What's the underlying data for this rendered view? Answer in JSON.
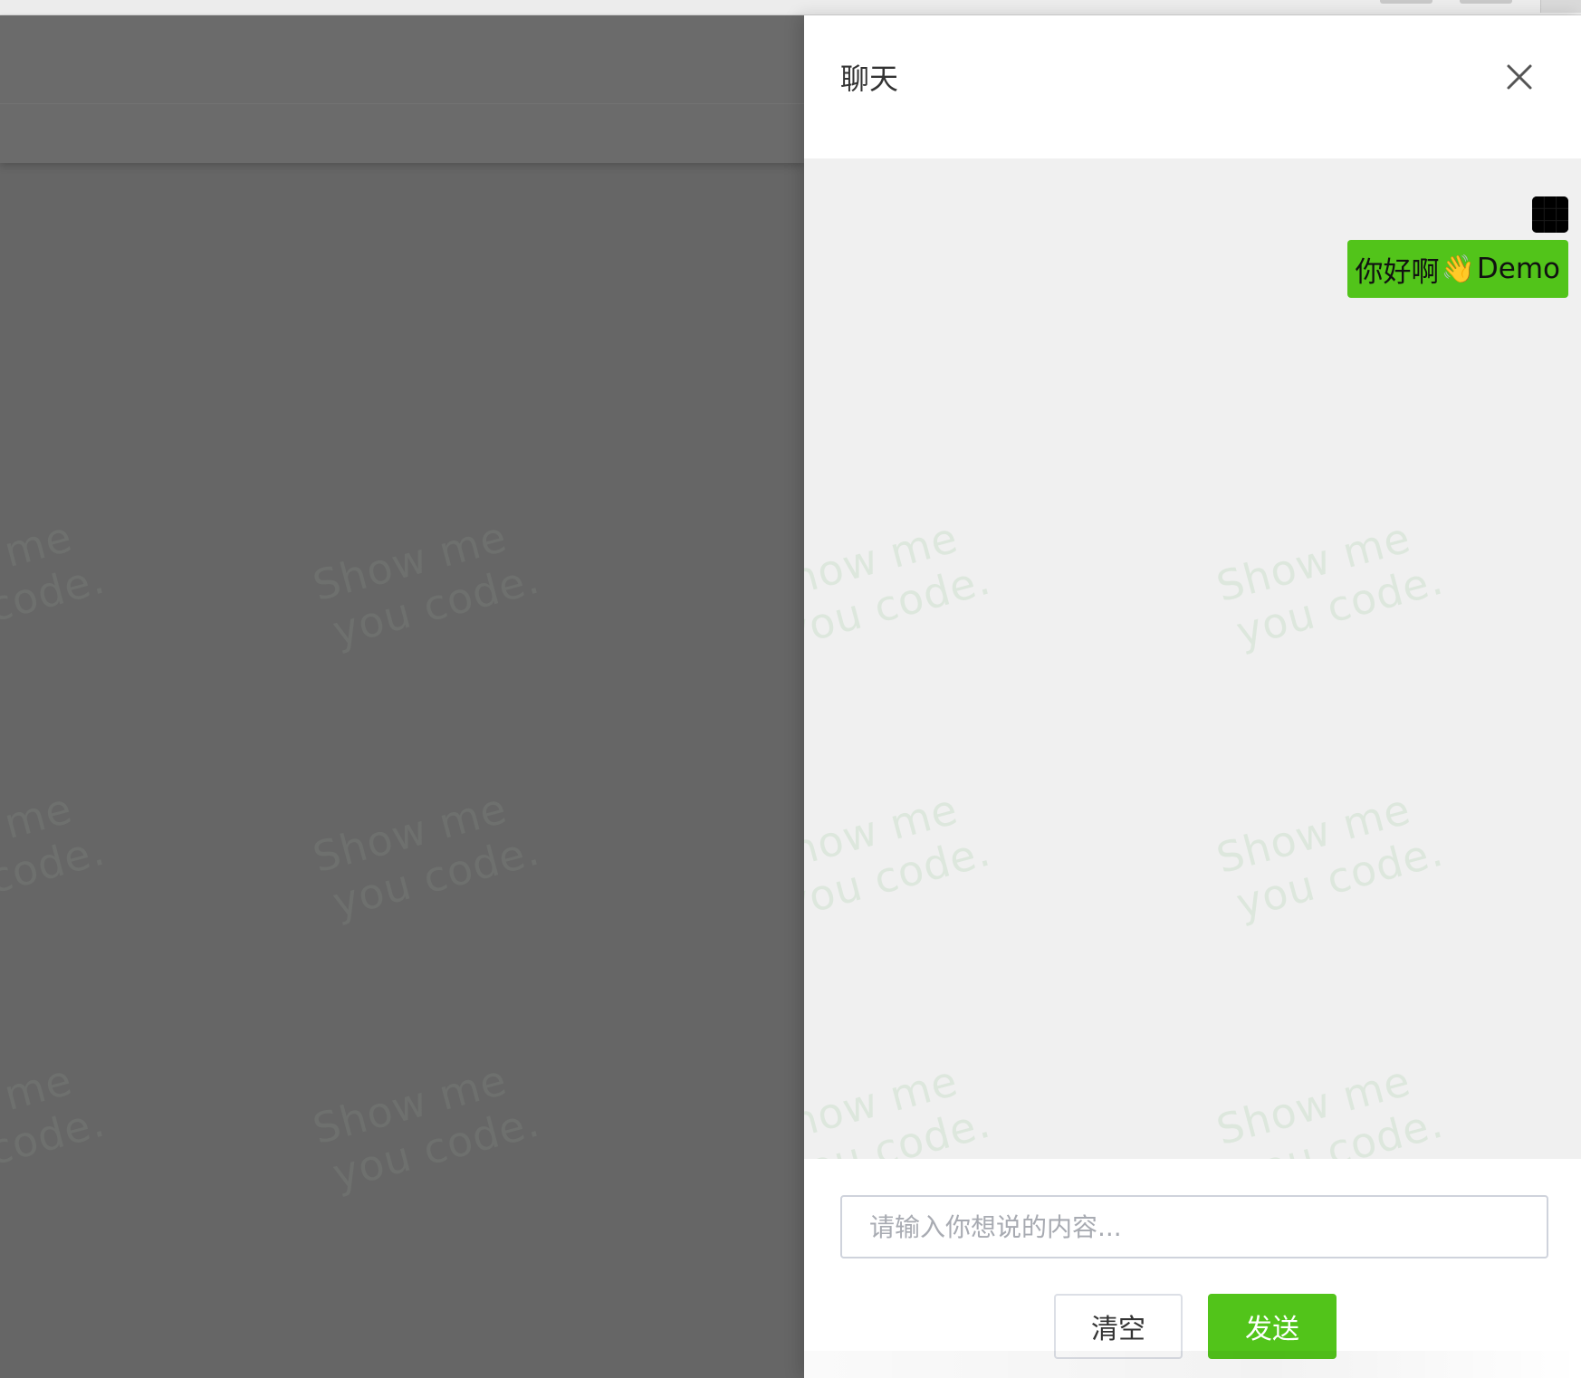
{
  "drawer": {
    "title": "聊天"
  },
  "messages": [
    {
      "text_before": "你好啊",
      "emoji": "👋",
      "text_after": "Demo",
      "bubble_color": "#52c41a"
    }
  ],
  "watermark": {
    "line1": "Show me",
    "line2": "you code."
  },
  "composer": {
    "placeholder": "请输入你想说的内容...",
    "value": "",
    "clear_label": "清空",
    "send_label": "发送"
  },
  "colors": {
    "accent": "#52c41a",
    "chat_background": "#f0f0f0",
    "mask": "#666666",
    "avatar": "#000000"
  },
  "icons": {
    "close": "close-icon",
    "wave": "waving-hand-emoji"
  }
}
